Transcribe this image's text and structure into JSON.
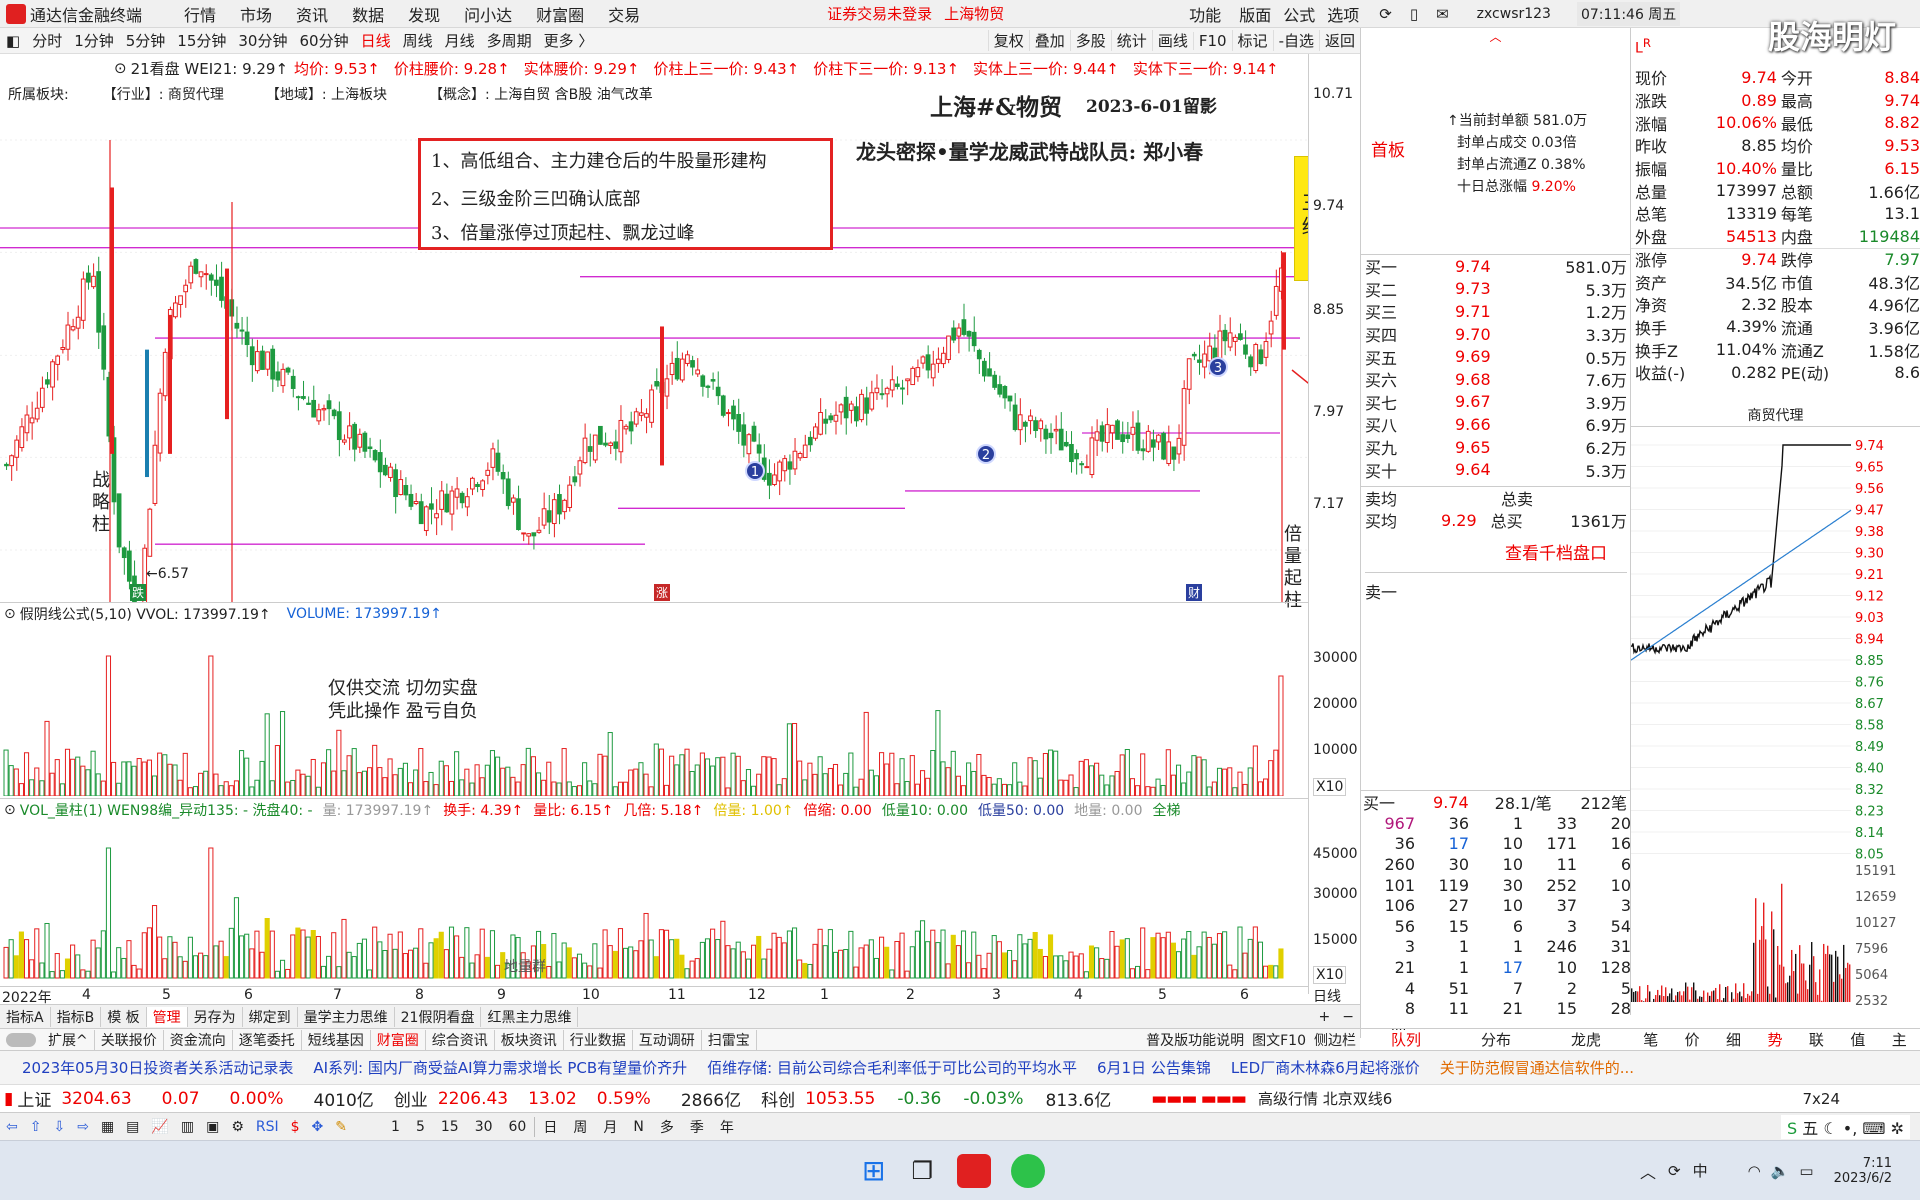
{
  "app": {
    "title": "通达信金融终端",
    "menu": [
      "行情",
      "市场",
      "资讯",
      "数据",
      "发现",
      "问小达",
      "财富圈",
      "交易"
    ],
    "warning": "证券交易未登录",
    "stock_title": "上海物贸",
    "right_menu": [
      "功能",
      "版面",
      "公式",
      "选项"
    ],
    "user": "zxcwsr123",
    "clock": "07:11:46 周五",
    "watermark": "股海明灯"
  },
  "period": {
    "items": [
      "分时",
      "1分钟",
      "5分钟",
      "15分钟",
      "30分钟",
      "60分钟",
      "日线",
      "周线",
      "月线",
      "多周期",
      "更多 〉"
    ],
    "active": "日线",
    "tools": [
      "复权",
      "叠加",
      "多股",
      "统计",
      "画线",
      "F10",
      "标记",
      "-自选",
      "返回"
    ]
  },
  "info": {
    "prefix": "21看盘 WEI21: 9.29↑",
    "items": [
      {
        "t": "均价: 9.53↑",
        "c": "#e00"
      },
      {
        "t": "价柱腰价: 9.28↑",
        "c": "#e00"
      },
      {
        "t": "实体腰价: 9.29↑",
        "c": "#e00"
      },
      {
        "t": "价柱上三一价: 9.43↑",
        "c": "#e00"
      },
      {
        "t": "价柱下三一价: 9.13↑",
        "c": "#e00"
      },
      {
        "t": "实体上三一价: 9.44↑",
        "c": "#e00"
      },
      {
        "t": "实体下三一价: 9.14↑",
        "c": "#e00"
      }
    ]
  },
  "sector": {
    "label": "所属板块:",
    "industry": "【行业】: 商贸代理",
    "region": "【地域】: 上海板块",
    "concept": "【概念】: 上海自贸 含B股 油气改革"
  },
  "annotations": {
    "title": "上海#&物贸",
    "date": "2023-6-01留影",
    "author": "龙头密探•量学龙威武特战队员: 郑小春",
    "notes": [
      "1、高低组合、主力建仓后的牛股量形建构",
      "2、三级金阶三凹确认底部",
      "3、倍量涨停过顶起柱、飘龙过峰"
    ],
    "strategy": "战略柱",
    "threeline": "三线",
    "double": "倍量起柱",
    "disclaimer1": "仅供交流 切勿实盘",
    "disclaimer2": "凭此操作 盈亏自负",
    "low": "←6.57",
    "markers": [
      "1",
      "2",
      "3"
    ],
    "tag_die": "跌",
    "tag_zhang": "涨",
    "tag_cai": "财"
  },
  "price_axis": [
    "10.71",
    "9.74",
    "8.85",
    "7.97",
    "7.17"
  ],
  "vol_panel": {
    "header": "假阴线公式(5,10) VVOL: 173997.19↑",
    "volume": "VOLUME: 173997.19↑",
    "axis": [
      "30000",
      "20000",
      "10000"
    ],
    "scale": "X10"
  },
  "vol2_panel": {
    "header": "VOL_量柱(1) WEN98编_异动135: - 洗盘40: -",
    "items": [
      "量: 173997.19↑",
      "换手: 4.39↑",
      "量比: 6.15↑",
      "几倍: 5.18↑",
      "倍量: 1.00↑",
      "倍缩: 0.00",
      "低量10: 0.00",
      "低量50: 0.00",
      "地量: 0.00",
      "全梯"
    ],
    "axis": [
      "45000",
      "30000",
      "15000"
    ],
    "scale": "X10",
    "ground": "地量群",
    "period": "日线"
  },
  "xaxis": {
    "year": "2022年",
    "months": [
      "4",
      "5",
      "6",
      "7",
      "8",
      "9",
      "10",
      "11",
      "12",
      "1",
      "2",
      "3",
      "4",
      "5",
      "6"
    ]
  },
  "seal": {
    "label": "首板",
    "rows": [
      "↑当前封单额 581.0万",
      "封单占成交 0.03倍",
      "封单占流通Z 0.38%"
    ],
    "ten": "十日总涨幅",
    "ten_val": "9.20%"
  },
  "buy": [
    {
      "n": "买一",
      "p": "9.74",
      "v": "581.0万"
    },
    {
      "n": "买二",
      "p": "9.73",
      "v": "5.3万"
    },
    {
      "n": "买三",
      "p": "9.71",
      "v": "1.2万"
    },
    {
      "n": "买四",
      "p": "9.70",
      "v": "3.3万"
    },
    {
      "n": "买五",
      "p": "9.69",
      "v": "0.5万"
    },
    {
      "n": "买六",
      "p": "9.68",
      "v": "7.6万"
    },
    {
      "n": "买七",
      "p": "9.67",
      "v": "3.9万"
    },
    {
      "n": "买八",
      "p": "9.66",
      "v": "6.9万"
    },
    {
      "n": "买九",
      "p": "9.65",
      "v": "6.2万"
    },
    {
      "n": "买十",
      "p": "9.64",
      "v": "5.3万"
    }
  ],
  "avg": {
    "sell_avg": "卖均",
    "total_sell": "总卖",
    "buy_avg": "买均",
    "buy_avg_val": "9.29",
    "total_buy": "总买",
    "total_buy_val": "1361万",
    "link": "查看千档盘口",
    "sell1": "卖一"
  },
  "queue": {
    "head": [
      "买一",
      "9.74",
      "28.1/笔",
      "212笔"
    ],
    "rows": [
      [
        "967",
        "36",
        "1",
        "33",
        "20"
      ],
      [
        "36",
        "17",
        "10",
        "171",
        "16"
      ],
      [
        "260",
        "30",
        "10",
        "11",
        "6"
      ],
      [
        "101",
        "119",
        "30",
        "252",
        "10"
      ],
      [
        "106",
        "27",
        "10",
        "37",
        "3"
      ],
      [
        "56",
        "15",
        "6",
        "3",
        "54"
      ],
      [
        "3",
        "1",
        "1",
        "246",
        "31"
      ],
      [
        "21",
        "1",
        "17",
        "10",
        "128"
      ],
      [
        "4",
        "51",
        "7",
        "2",
        "5"
      ],
      [
        "8",
        "11",
        "21",
        "15",
        "28"
      ]
    ],
    "more": "....",
    "tabs": [
      "队列",
      "分布",
      "龙虎"
    ]
  },
  "quote": [
    [
      "现价",
      "9.74",
      "今开",
      "8.84"
    ],
    [
      "涨跌",
      "0.89",
      "最高",
      "9.74"
    ],
    [
      "涨幅",
      "10.06%",
      "最低",
      "8.82"
    ],
    [
      "昨收",
      "8.85",
      "均价",
      "9.53"
    ],
    [
      "振幅",
      "10.40%",
      "量比",
      "6.15"
    ],
    [
      "总量",
      "173997",
      "总额",
      "1.66亿"
    ],
    [
      "总笔",
      "13319",
      "每笔",
      "13.1"
    ],
    [
      "外盘",
      "54513",
      "内盘",
      "119484"
    ],
    [
      "涨停",
      "9.74",
      "跌停",
      "7.97"
    ],
    [
      "资产",
      "34.5亿",
      "市值",
      "48.3亿"
    ],
    [
      "净资",
      "2.32",
      "股本",
      "4.96亿"
    ],
    [
      "换手",
      "4.39%",
      "流通",
      "3.96亿"
    ],
    [
      "换手Z",
      "11.04%",
      "流通Z",
      "1.58亿"
    ],
    [
      "收益(-)",
      "0.282",
      "PE(动)",
      "8.6"
    ]
  ],
  "mini": {
    "title": "商贸代理",
    "axis": [
      "9.74",
      "9.65",
      "9.56",
      "9.47",
      "9.38",
      "9.30",
      "9.21",
      "9.12",
      "9.03",
      "8.94",
      "8.85",
      "8.76",
      "8.67",
      "8.58",
      "8.49",
      "8.40",
      "8.32",
      "8.23",
      "8.14",
      "8.05"
    ],
    "vaxis": [
      "15191",
      "12659",
      "10127",
      "7596",
      "5064",
      "2532"
    ],
    "tabs": [
      "笔",
      "价",
      "细",
      "势",
      "联",
      "值",
      "主"
    ]
  },
  "bottomtabs": [
    "指标A",
    "指标B",
    "模 板",
    "管理",
    "另存为",
    "绑定到",
    "量学主力思维",
    "21假阴看盘",
    "红黑主力思维"
  ],
  "subtabs": [
    "扩展^",
    "关联报价",
    "资金流向",
    "逐笔委托",
    "短线基因",
    "财富圈",
    "综合资讯",
    "板块资讯",
    "行业数据",
    "互动调研",
    "扫雷宝"
  ],
  "subtabs_right": [
    "普及版功能说明",
    "图文F10",
    "侧边栏"
  ],
  "news": [
    "2023年05月30日投资者关系活动记录表",
    "AI系列: 国内厂商受益AI算力需求增长 PCB有望量价齐升",
    "佰维存储: 目前公司综合毛利率低于可比公司的平均水平",
    "6月1日 公告集锦",
    "LED厂商木林森6月起将涨价",
    "关于防范假冒通达信软件的..."
  ],
  "index": {
    "sh": "上证",
    "sh_v": "3204.63",
    "sh_c": "0.07",
    "sh_p": "0.00%",
    "sh_a": "4010亿",
    "cy": "创业",
    "cy_v": "2206.43",
    "cy_c": "13.02",
    "cy_p": "0.59%",
    "cy_a": "2866亿",
    "kc": "科创",
    "kc_v": "1053.55",
    "kc_c": "-0.36",
    "kc_p": "-0.03%",
    "kc_a": "813.6亿",
    "adv": "高级行情 北京双线6",
    "mode": "7x24"
  },
  "toolbar2": [
    "1",
    "5",
    "15",
    "30",
    "60",
    "日",
    "周",
    "月",
    "N",
    "多",
    "季",
    "年"
  ],
  "taskbar": {
    "time": "7:11",
    "date": "2023/6/2"
  }
}
